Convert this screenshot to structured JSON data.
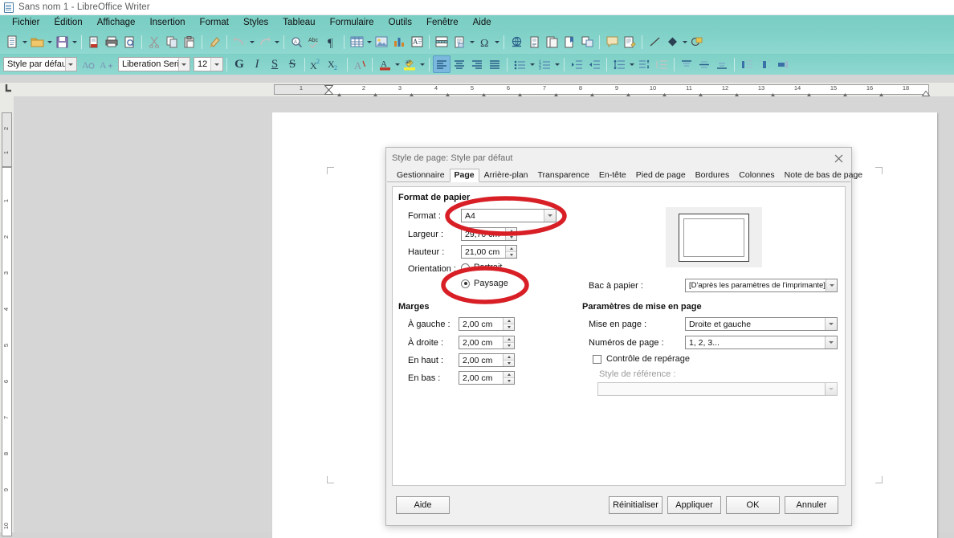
{
  "window": {
    "title": "Sans nom 1 - LibreOffice Writer",
    "icon": "writer-document-icon"
  },
  "menubar": {
    "items": [
      {
        "label": "Fichier"
      },
      {
        "label": "Édition"
      },
      {
        "label": "Affichage"
      },
      {
        "label": "Insertion"
      },
      {
        "label": "Format"
      },
      {
        "label": "Styles"
      },
      {
        "label": "Tableau"
      },
      {
        "label": "Formulaire"
      },
      {
        "label": "Outils"
      },
      {
        "label": "Fenêtre"
      },
      {
        "label": "Aide"
      }
    ]
  },
  "standard_toolbar": {
    "icons": [
      "new-document-icon",
      "open-folder-icon",
      "save-icon",
      "export-pdf-icon",
      "print-icon",
      "print-preview-icon",
      "cut-icon",
      "copy-icon",
      "paste-icon",
      "clone-formatting-icon",
      "undo-icon",
      "redo-icon",
      "find-replace-icon",
      "spelling-icon",
      "formatting-marks-icon",
      "insert-table-icon",
      "insert-image-icon",
      "insert-chart-icon",
      "insert-textbox-icon",
      "page-break-icon",
      "insert-field-icon",
      "insert-special-character-icon",
      "insert-hyperlink-icon",
      "insert-footnote-icon",
      "insert-endnote-icon",
      "insert-bookmark-icon",
      "insert-cross-reference-icon",
      "insert-comment-icon",
      "track-changes-icon",
      "insert-line-icon",
      "basic-shapes-icon",
      "show-draw-functions-icon"
    ]
  },
  "formatting_toolbar": {
    "paragraph_style": "Style par défaut",
    "font_name": "Liberation Serif",
    "font_size": "12",
    "icons": [
      "update-style-icon",
      "new-style-icon",
      "bold-icon",
      "italic-icon",
      "underline-icon",
      "strikethrough-icon",
      "superscript-icon",
      "subscript-icon",
      "clear-formatting-icon",
      "font-color-icon",
      "highlighting-color-icon",
      "align-left-icon",
      "align-center-icon",
      "align-right-icon",
      "justified-icon",
      "unordered-list-icon",
      "ordered-list-icon",
      "increase-indent-icon",
      "decrease-indent-icon",
      "line-spacing-icon",
      "paragraph-spacing-icon",
      "no-list-icon",
      "align-top-icon",
      "center-vertically-icon",
      "align-bottom-icon",
      "table-align-left-icon",
      "table-align-center-icon",
      "table-align-right-icon"
    ],
    "bold_glyph": "G",
    "italic_glyph": "I",
    "underline_glyph": "S",
    "strikethrough_glyph": "S"
  },
  "ruler": {
    "horizontal_labels": [
      "1",
      "1",
      "2",
      "3",
      "4",
      "5",
      "6",
      "7",
      "8",
      "9",
      "10",
      "11",
      "12",
      "13",
      "14",
      "15",
      "16",
      "17",
      "18"
    ],
    "vertical_labels": [
      "2",
      "1",
      "1",
      "2",
      "3",
      "4",
      "5",
      "6",
      "7",
      "8",
      "9",
      "10"
    ],
    "unit": "cm"
  },
  "dialog": {
    "title": "Style de page: Style par défaut",
    "close_icon": "close-icon",
    "tabs": [
      {
        "label": "Gestionnaire",
        "active": false
      },
      {
        "label": "Page",
        "active": true
      },
      {
        "label": "Arrière-plan",
        "active": false
      },
      {
        "label": "Transparence",
        "active": false
      },
      {
        "label": "En-tête",
        "active": false
      },
      {
        "label": "Pied de page",
        "active": false
      },
      {
        "label": "Bordures",
        "active": false
      },
      {
        "label": "Colonnes",
        "active": false
      },
      {
        "label": "Note de bas de page",
        "active": false
      }
    ],
    "paper_format": {
      "section_title": "Format de papier",
      "format_label": "Format :",
      "format_value": "A4",
      "width_label": "Largeur :",
      "width_value": "29,70 cm",
      "height_label": "Hauteur :",
      "height_value": "21,00 cm",
      "orientation_label": "Orientation :",
      "portrait_label": "Portrait",
      "landscape_label": "Paysage",
      "selected_orientation": "Paysage"
    },
    "margins": {
      "section_title": "Marges",
      "left_label": "À gauche :",
      "left_value": "2,00 cm",
      "right_label": "À droite :",
      "right_value": "2,00 cm",
      "top_label": "En haut :",
      "top_value": "2,00 cm",
      "bottom_label": "En bas :",
      "bottom_value": "2,00 cm"
    },
    "paper_tray": {
      "label": "Bac à papier :",
      "value": "[D'après les paramètres de l'imprimante]"
    },
    "layout_settings": {
      "section_title": "Paramètres de mise en page",
      "page_layout_label": "Mise en page :",
      "page_layout_value": "Droite et gauche",
      "page_numbers_label": "Numéros de page :",
      "page_numbers_value": "1, 2, 3...",
      "register_true_label": "Contrôle de repérage",
      "register_true_checked": false,
      "reference_style_label": "Style de référence :",
      "reference_style_value": ""
    },
    "preview": {
      "name": "page-preview"
    },
    "buttons": {
      "help": "Aide",
      "reset": "Réinitialiser",
      "apply": "Appliquer",
      "ok": "OK",
      "cancel": "Annuler"
    }
  },
  "annotations": {
    "color": "#d81f26",
    "items": [
      {
        "name": "format-highlight-ellipse"
      },
      {
        "name": "paysage-highlight-ellipse"
      }
    ]
  },
  "colors": {
    "toolbar_teal": "#82d2c9",
    "menubar_teal": "#7ccfc5",
    "workspace_gray": "#d6d6d6",
    "dialog_gray": "#f0f0f0",
    "annotation_red": "#d81f26"
  }
}
